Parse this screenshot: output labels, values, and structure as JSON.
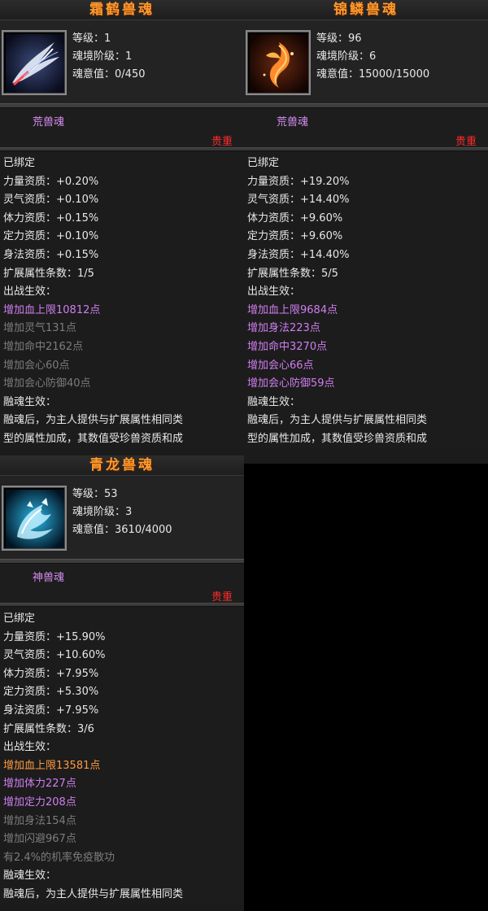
{
  "cards": [
    {
      "name": "霜鹤兽魂",
      "level_label": "等级：",
      "level": "1",
      "tier_label": "魂境阶级：",
      "tier": "1",
      "soul_label": "魂意值：",
      "soul": "0/450",
      "type": "荒兽魂",
      "quality": "贵重",
      "bound": "已绑定",
      "attributes": [
        "力量资质：+0.20%",
        "灵气资质：+0.10%",
        "体力资质：+0.15%",
        "定力资质：+0.10%",
        "身法资质：+0.15%",
        "扩展属性条数：1/5"
      ],
      "battle_label": "出战生效：",
      "effects": [
        {
          "text": "增加血上限10812点",
          "color": "purple"
        },
        {
          "text": "增加灵气131点",
          "color": "gray"
        },
        {
          "text": "增加命中2162点",
          "color": "gray"
        },
        {
          "text": "增加会心60点",
          "color": "gray"
        },
        {
          "text": "增加会心防御40点",
          "color": "gray"
        }
      ],
      "fusion_label": "融魂生效：",
      "fusion_text": [
        "融魂后，为主人提供与扩展属性相同类",
        "型的属性加成，其数值受珍兽资质和成"
      ]
    },
    {
      "name": "锦鳞兽魂",
      "level_label": "等级：",
      "level": "96",
      "tier_label": "魂境阶级：",
      "tier": "6",
      "soul_label": "魂意值：",
      "soul": "15000/15000",
      "type": "荒兽魂",
      "quality": "贵重",
      "bound": "已绑定",
      "attributes": [
        "力量资质：+19.20%",
        "灵气资质：+14.40%",
        "体力资质：+9.60%",
        "定力资质：+9.60%",
        "身法资质：+14.40%",
        "扩展属性条数：5/5"
      ],
      "battle_label": "出战生效：",
      "effects": [
        {
          "text": "增加血上限9684点",
          "color": "purple"
        },
        {
          "text": "增加身法223点",
          "color": "purple"
        },
        {
          "text": "增加命中3270点",
          "color": "purple"
        },
        {
          "text": "增加会心66点",
          "color": "purple"
        },
        {
          "text": "增加会心防御59点",
          "color": "purple"
        }
      ],
      "fusion_label": "融魂生效：",
      "fusion_text": [
        "融魂后，为主人提供与扩展属性相同类",
        "型的属性加成，其数值受珍兽资质和成"
      ]
    },
    {
      "name": "青龙兽魂",
      "level_label": "等级：",
      "level": "53",
      "tier_label": "魂境阶级：",
      "tier": "3",
      "soul_label": "魂意值：",
      "soul": "3610/4000",
      "type": "神兽魂",
      "quality": "贵重",
      "bound": "已绑定",
      "attributes": [
        "力量资质：+15.90%",
        "灵气资质：+10.60%",
        "体力资质：+7.95%",
        "定力资质：+5.30%",
        "身法资质：+7.95%",
        "扩展属性条数：3/6"
      ],
      "battle_label": "出战生效：",
      "effects": [
        {
          "text": "增加血上限13581点",
          "color": "orange"
        },
        {
          "text": "增加体力227点",
          "color": "purple"
        },
        {
          "text": "增加定力208点",
          "color": "purple"
        },
        {
          "text": "增加身法154点",
          "color": "gray"
        },
        {
          "text": "增加闪避967点",
          "color": "gray"
        },
        {
          "text": "有2.4%的机率免疫散功",
          "color": "gray"
        }
      ],
      "fusion_label": "融魂生效：",
      "fusion_text": [
        "融魂后，为主人提供与扩展属性相同类"
      ]
    }
  ],
  "colors": {
    "title": "#ff9a2e",
    "type": "#d58cf0",
    "quality": "#ff2a2a",
    "purple": "#d07ef0",
    "gray": "#7c7c7c",
    "orange": "#ff9a3e"
  },
  "icons": [
    "crane-wing-icon",
    "fire-fish-icon",
    "blue-dragon-icon"
  ]
}
